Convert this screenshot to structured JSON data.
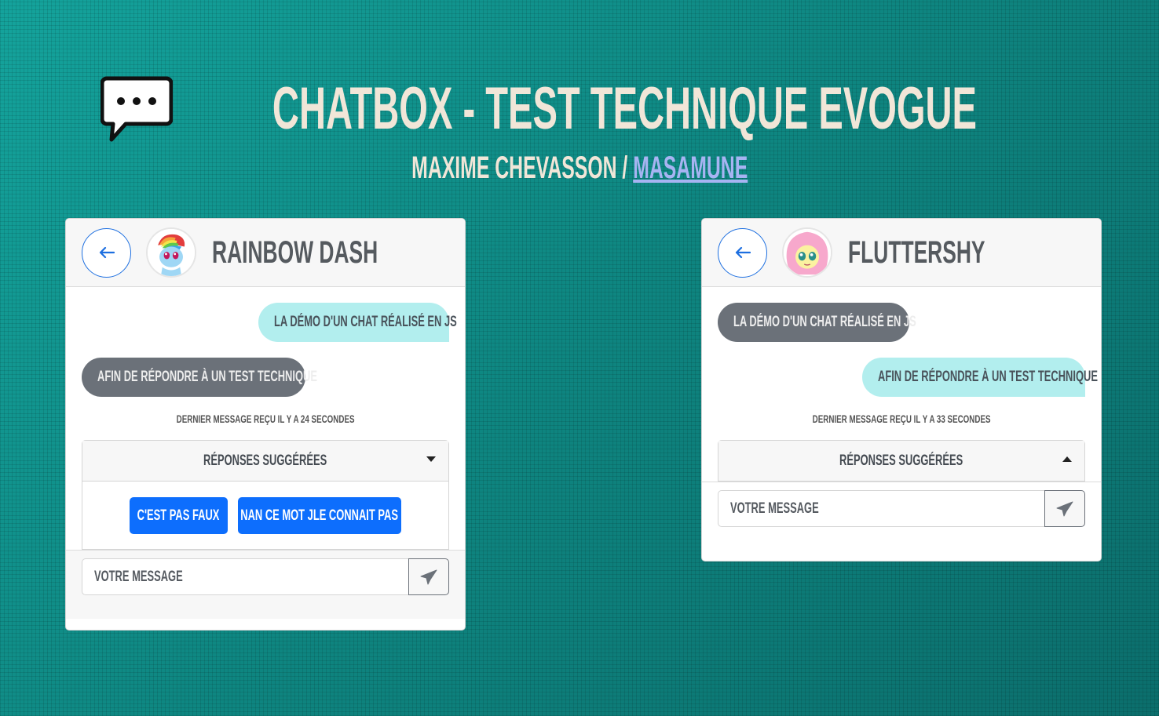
{
  "header": {
    "title": "CHATBOX - TEST TECHNIQUE EVOGUE",
    "author": "MAXIME CHEVASSON / ",
    "author_link": "MASAMUNE"
  },
  "chat_left": {
    "name": "RAINBOW DASH",
    "messages": [
      {
        "from": "me",
        "text": "LA DÉMO D'UN CHAT RÉALISÉ EN JS"
      },
      {
        "from": "them",
        "text": "AFIN DE RÉPONDRE À UN TEST TECHNIQUE"
      }
    ],
    "last_message": "DERNIER MESSAGE REÇU IL Y A 24 SECONDES",
    "suggest_label": "RÉPONSES SUGGÉRÉES",
    "suggestions": [
      "C'EST PAS FAUX",
      "NAN CE MOT JLE CONNAIT PAS"
    ],
    "input_placeholder": "VOTRE MESSAGE"
  },
  "chat_right": {
    "name": "FLUTTERSHY",
    "messages": [
      {
        "from": "them",
        "text": "LA DÉMO D'UN CHAT RÉALISÉ EN JS"
      },
      {
        "from": "me",
        "text": "AFIN DE RÉPONDRE À UN TEST TECHNIQUE"
      }
    ],
    "last_message": "DERNIER MESSAGE REÇU IL Y A 33 SECONDES",
    "suggest_label": "RÉPONSES SUGGÉRÉES",
    "input_placeholder": "VOTRE MESSAGE"
  },
  "colors": {
    "background": "#0f8a86",
    "title": "#f1e6d8",
    "link": "#a7b4f2",
    "bubble_me": "#b2eeee",
    "bubble_them": "#6b7179",
    "primary": "#0d6efd"
  }
}
